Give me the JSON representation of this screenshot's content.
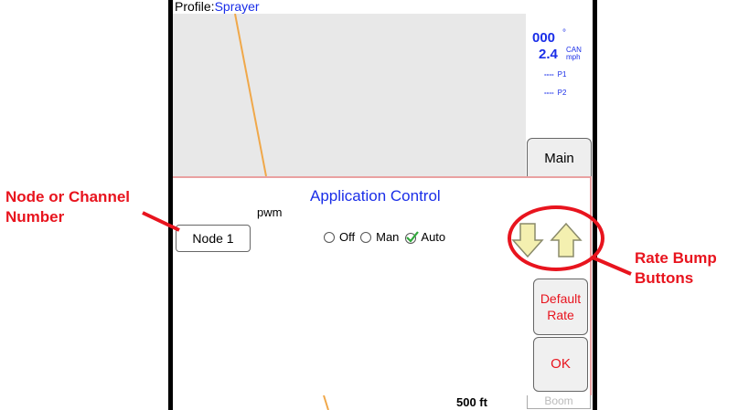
{
  "annotations": {
    "node_callout": "Node or Channel Number",
    "rate_callout": "Rate Bump Buttons"
  },
  "status": {
    "profile_label": "Profile:",
    "profile_value": "Sprayer",
    "heading_value": "000",
    "heading_unit": "°",
    "speed_value": "2.4",
    "speed_source": "CAN",
    "speed_unit": "mph",
    "p1_value": "----",
    "p1_label": "P1",
    "p2_value": "----",
    "p2_label": "P2"
  },
  "tabs": {
    "main": "Main",
    "boom": "Boom"
  },
  "dialog": {
    "title": "Application Control",
    "mode_label": "pwm",
    "node_button": "Node 1",
    "radio_off": "Off",
    "radio_man": "Man",
    "radio_auto": "Auto",
    "selected_mode": "Auto",
    "default_rate_line1": "Default",
    "default_rate_line2": "Rate",
    "ok": "OK"
  },
  "map": {
    "scale": "500 ft"
  },
  "colors": {
    "accent_blue": "#1a2ee8",
    "alert_red": "#e8141e",
    "arrow_fill": "#f4f0b0"
  }
}
